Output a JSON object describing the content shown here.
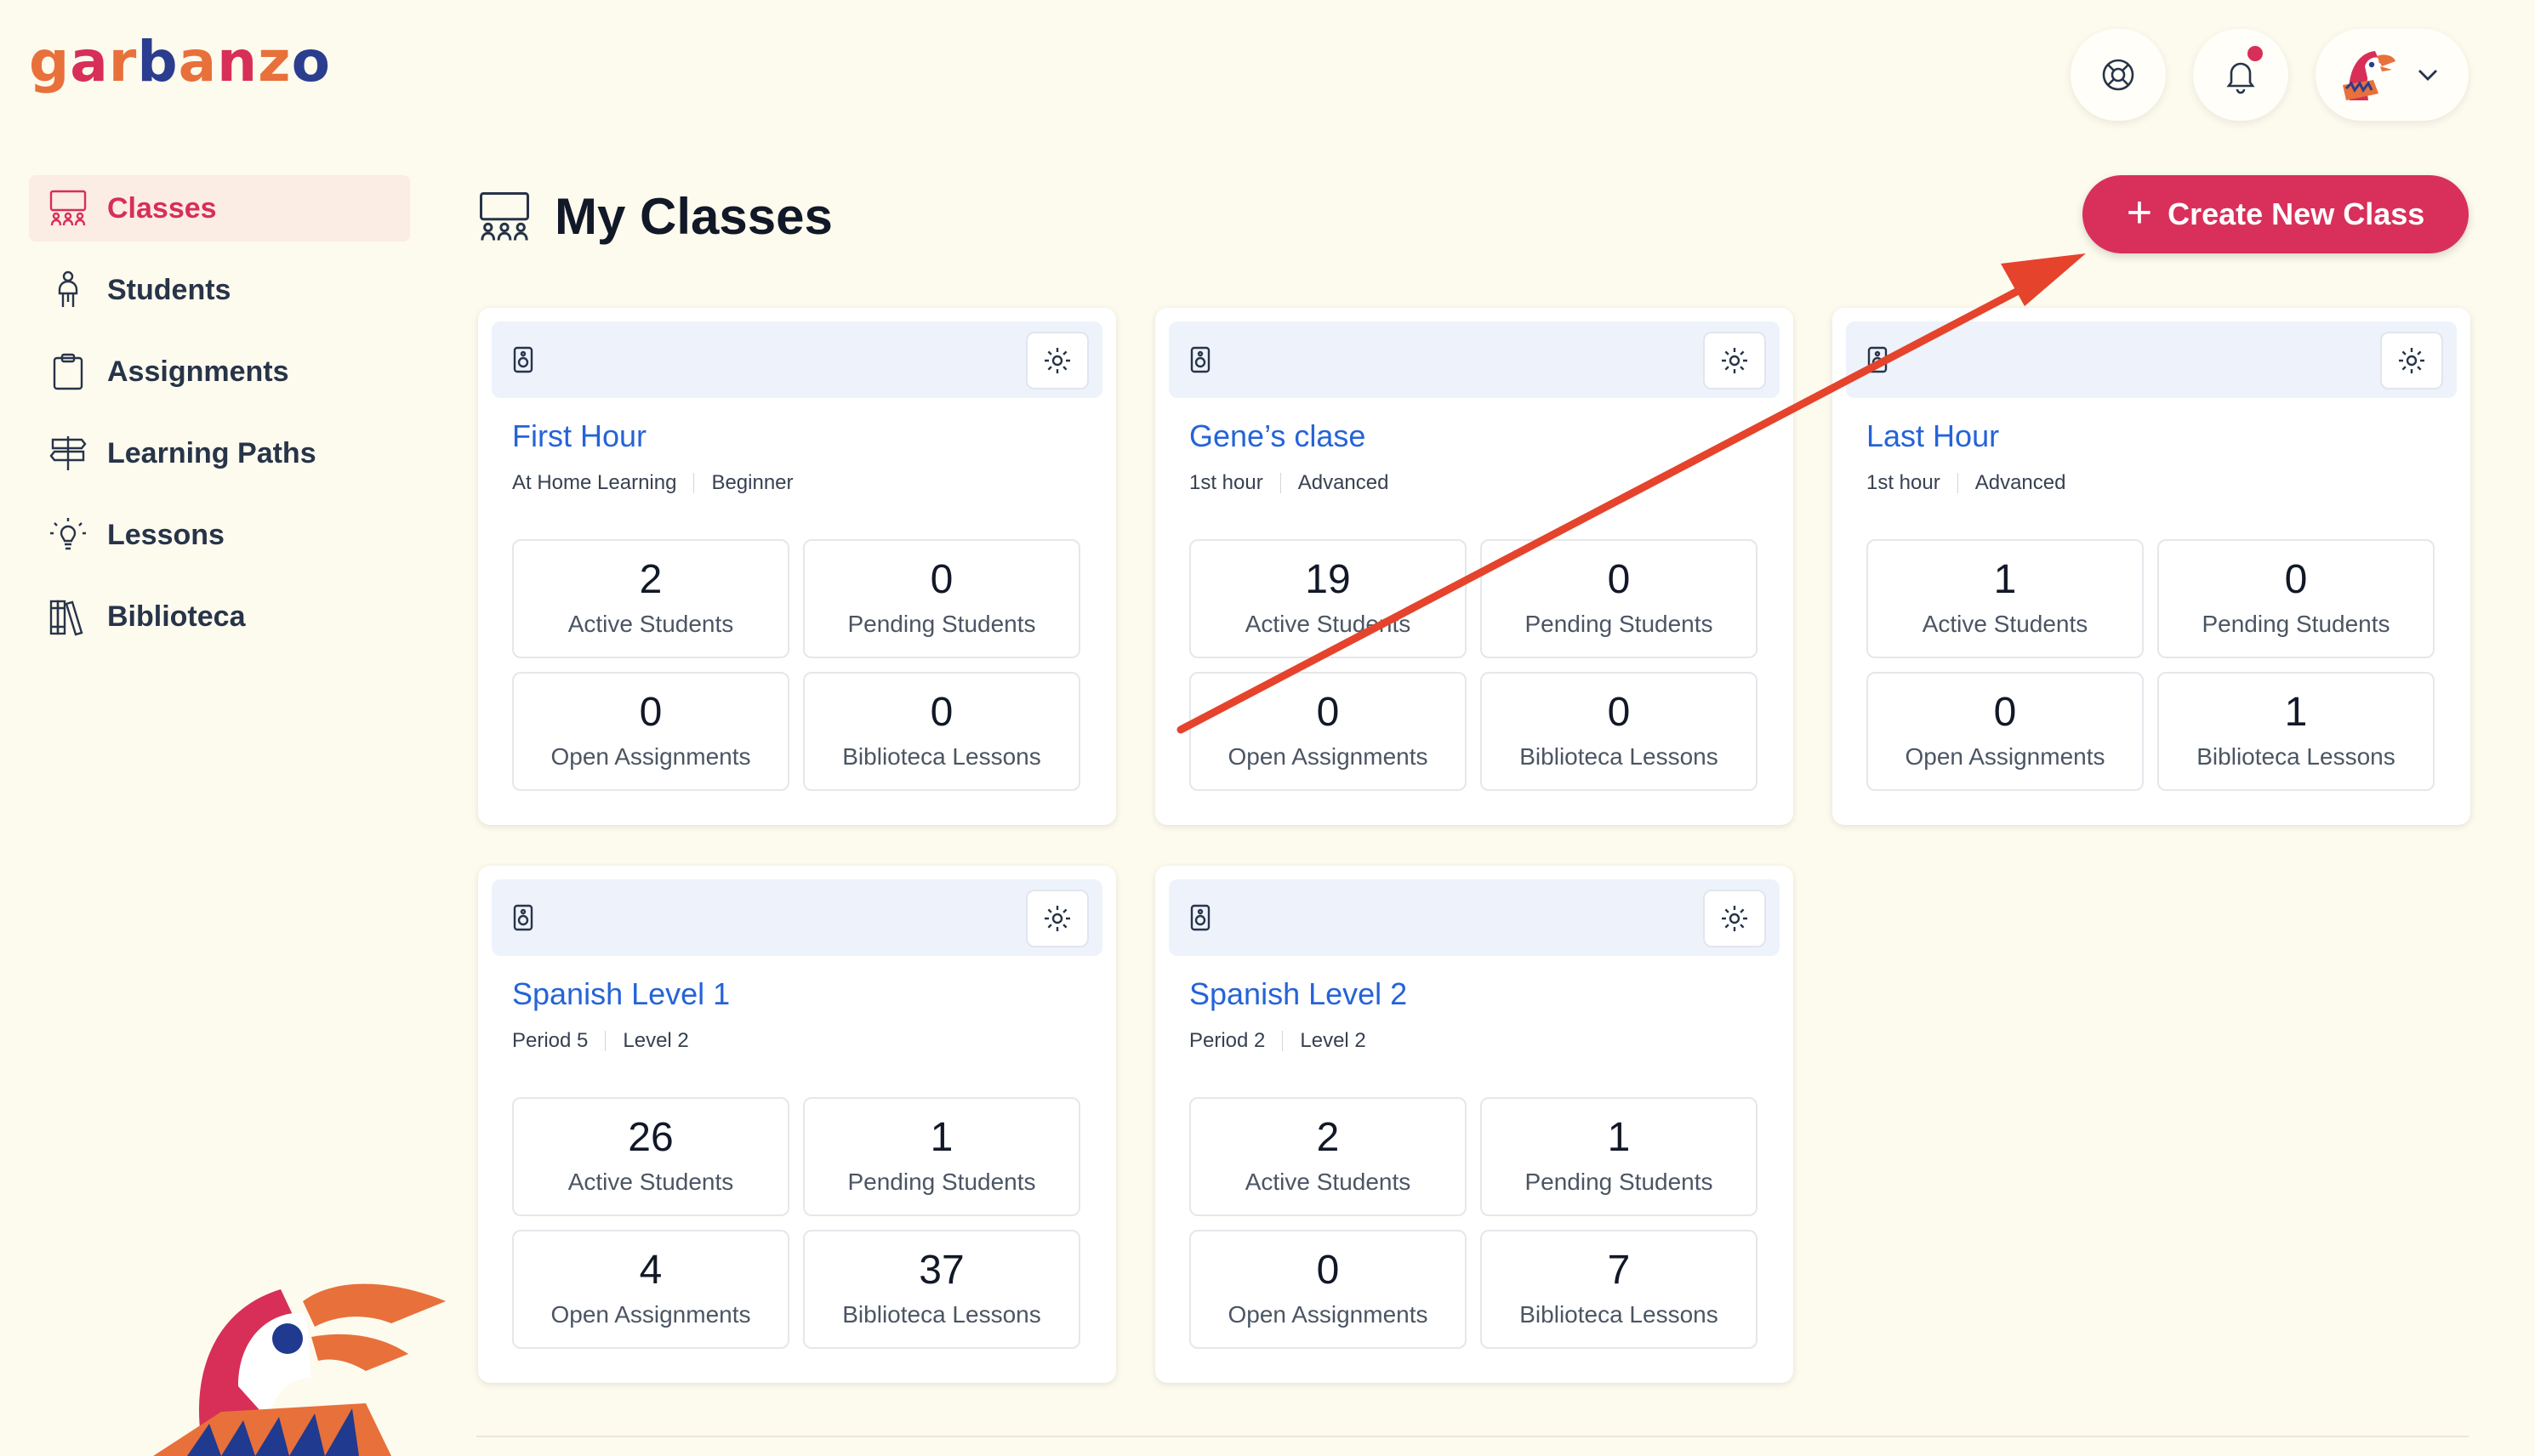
{
  "app": {
    "logo_letters": [
      {
        "ch": "g",
        "color": "#e8703a"
      },
      {
        "ch": "a",
        "color": "#d72f57"
      },
      {
        "ch": "r",
        "color": "#e8703a"
      },
      {
        "ch": "b",
        "color": "#2a3d8f"
      },
      {
        "ch": "a",
        "color": "#e8703a"
      },
      {
        "ch": "n",
        "color": "#d72f57"
      },
      {
        "ch": "z",
        "color": "#e8703a"
      },
      {
        "ch": "o",
        "color": "#2a3d8f"
      }
    ],
    "accent_color": "#d9305b",
    "link_color": "#2563d8"
  },
  "sidebar": {
    "items": [
      {
        "label": "Classes",
        "icon": "classroom-icon",
        "active": true
      },
      {
        "label": "Students",
        "icon": "student-icon",
        "active": false
      },
      {
        "label": "Assignments",
        "icon": "clipboard-icon",
        "active": false
      },
      {
        "label": "Learning Paths",
        "icon": "signpost-icon",
        "active": false
      },
      {
        "label": "Lessons",
        "icon": "lightbulb-icon",
        "active": false
      },
      {
        "label": "Biblioteca",
        "icon": "books-icon",
        "active": false
      }
    ]
  },
  "header": {
    "help_icon": "lifebuoy-icon",
    "notifications_icon": "bell-icon",
    "profile_icon": "avatar-parrot-icon",
    "dropdown_icon": "chevron-down-icon"
  },
  "main": {
    "title": "My Classes",
    "create_button_label": "Create New Class"
  },
  "classes": [
    {
      "name": "First Hour",
      "period": "At Home Learning",
      "level": "Beginner",
      "stats": [
        {
          "value": "2",
          "label": "Active Students"
        },
        {
          "value": "0",
          "label": "Pending Students"
        },
        {
          "value": "0",
          "label": "Open Assignments"
        },
        {
          "value": "0",
          "label": "Biblioteca Lessons"
        }
      ]
    },
    {
      "name": "Gene’s clase",
      "period": "1st hour",
      "level": "Advanced",
      "stats": [
        {
          "value": "19",
          "label": "Active Students"
        },
        {
          "value": "0",
          "label": "Pending Students"
        },
        {
          "value": "0",
          "label": "Open Assignments"
        },
        {
          "value": "0",
          "label": "Biblioteca Lessons"
        }
      ]
    },
    {
      "name": "Last Hour",
      "period": "1st hour",
      "level": "Advanced",
      "stats": [
        {
          "value": "1",
          "label": "Active Students"
        },
        {
          "value": "0",
          "label": "Pending Students"
        },
        {
          "value": "0",
          "label": "Open Assignments"
        },
        {
          "value": "1",
          "label": "Biblioteca Lessons"
        }
      ]
    },
    {
      "name": "Spanish Level 1",
      "period": "Period 5",
      "level": "Level 2",
      "stats": [
        {
          "value": "26",
          "label": "Active Students"
        },
        {
          "value": "1",
          "label": "Pending Students"
        },
        {
          "value": "4",
          "label": "Open Assignments"
        },
        {
          "value": "37",
          "label": "Biblioteca Lessons"
        }
      ]
    },
    {
      "name": "Spanish Level 2",
      "period": "Period 2",
      "level": "Level 2",
      "stats": [
        {
          "value": "2",
          "label": "Active Students"
        },
        {
          "value": "1",
          "label": "Pending Students"
        },
        {
          "value": "0",
          "label": "Open Assignments"
        },
        {
          "value": "7",
          "label": "Biblioteca Lessons"
        }
      ]
    }
  ],
  "annotation": {
    "color": "#e5432c"
  }
}
